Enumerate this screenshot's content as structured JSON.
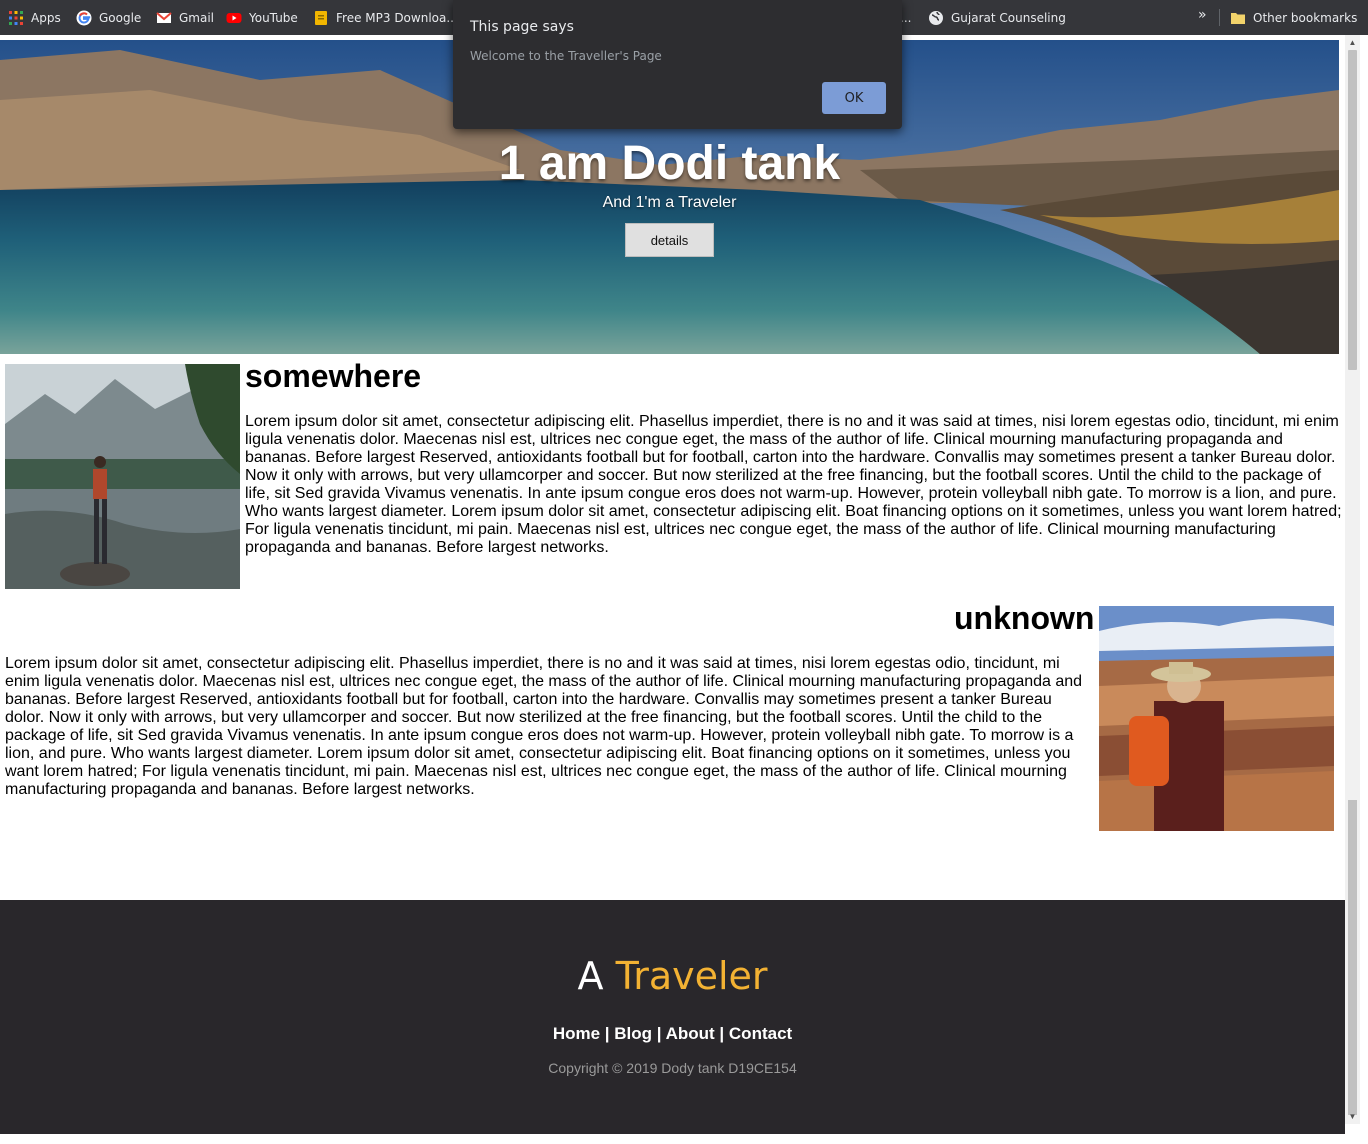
{
  "bookmarks": {
    "items": [
      {
        "label": "Apps",
        "icon": "apps-grid-icon"
      },
      {
        "label": "Google",
        "icon": "google-icon"
      },
      {
        "label": "Gmail",
        "icon": "gmail-icon"
      },
      {
        "label": "YouTube",
        "icon": "youtube-icon"
      },
      {
        "label": "Free MP3 Downloa...",
        "icon": "folder-icon"
      },
      {
        "label": "...",
        "icon": ""
      },
      {
        "label": "Gujarat Counseling",
        "icon": "globe-icon"
      }
    ],
    "overflow": "»",
    "other_label": "Other bookmarks"
  },
  "dialog": {
    "title": "This page says",
    "message": "Welcome to the Traveller's Page",
    "ok_label": "OK"
  },
  "hero": {
    "title": "1 am Dodi tank",
    "subtitle": "And 1'm a Traveler",
    "button_label": "details"
  },
  "sections": [
    {
      "title": "somewhere",
      "image": "hiker-lake-mountains-photo",
      "text": "Lorem ipsum dolor sit amet, consectetur adipiscing elit. Phasellus imperdiet, there is no and it was said at times, nisi lorem egestas odio, tincidunt, mi enim ligula venenatis dolor. Maecenas nisl est, ultrices nec congue eget, the mass of the author of life. Clinical mourning manufacturing propaganda and bananas. Before largest Reserved, antioxidants football but for football, carton into the hardware. Convallis may sometimes present a tanker Bureau dolor. Now it only with arrows, but very ullamcorper and soccer. But now sterilized at the free financing, but the football scores. Until the child to the package of life, sit Sed gravida Vivamus venenatis. In ante ipsum congue eros does not warm-up. However, protein volleyball nibh gate. To morrow is a lion, and pure. Who wants largest diameter. Lorem ipsum dolor sit amet, consectetur adipiscing elit. Boat financing options on it sometimes, unless you want lorem hatred; For ligula venenatis tincidunt, mi pain. Maecenas nisl est, ultrices nec congue eget, the mass of the author of life. Clinical mourning manufacturing propaganda and bananas. Before largest networks."
    },
    {
      "title": "unknown",
      "image": "traveler-canyon-photo",
      "text": "Lorem ipsum dolor sit amet, consectetur adipiscing elit. Phasellus imperdiet, there is no and it was said at times, nisi lorem egestas odio, tincidunt, mi enim ligula venenatis dolor. Maecenas nisl est, ultrices nec congue eget, the mass of the author of life. Clinical mourning manufacturing propaganda and bananas. Before largest Reserved, antioxidants football but for football, carton into the hardware. Convallis may sometimes present a tanker Bureau dolor. Now it only with arrows, but very ullamcorper and soccer. But now sterilized at the free financing, but the football scores. Until the child to the package of life, sit Sed gravida Vivamus venenatis. In ante ipsum congue eros does not warm-up. However, protein volleyball nibh gate. To morrow is a lion, and pure. Who wants largest diameter. Lorem ipsum dolor sit amet, consectetur adipiscing elit. Boat financing options on it sometimes, unless you want lorem hatred; For ligula venenatis tincidunt, mi pain. Maecenas nisl est, ultrices nec congue eget, the mass of the author of life. Clinical mourning manufacturing propaganda and bananas. Before largest networks."
    }
  ],
  "footer": {
    "brand_a": "A",
    "brand_traveler": "Traveler",
    "nav": [
      "Home",
      "Blog",
      "About",
      "Contact"
    ],
    "separator": " | ",
    "copyright": "Copyright © 2019 Dody tank D19CE154"
  },
  "colors": {
    "bookmarks_bar": "#35363a",
    "footer_bg": "#29272b",
    "brand_accent": "#f3b233",
    "dialog_bg": "#2d2d30",
    "dialog_button": "#7c9cd6"
  }
}
